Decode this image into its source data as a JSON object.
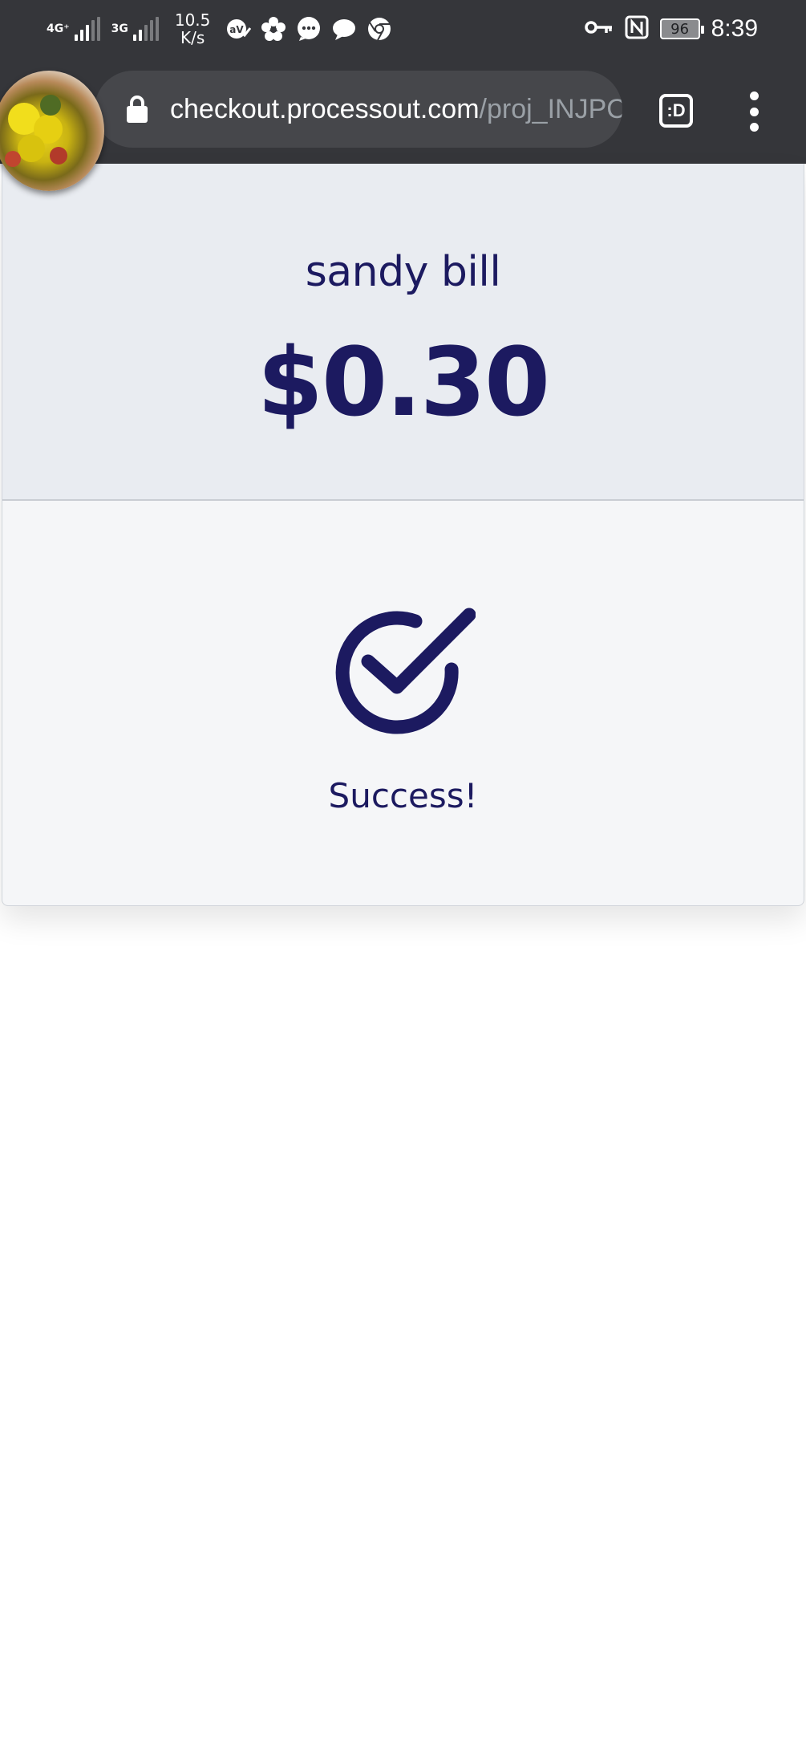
{
  "status_bar": {
    "network_1": "4G⁺",
    "network_2": "3G",
    "speed_value": "10.5",
    "speed_unit": "K/s",
    "battery": "96",
    "time": "8:39"
  },
  "browser": {
    "url_domain": "checkout.processout.com",
    "url_path": "/proj_INJPC",
    "tab_button_label": ":D"
  },
  "checkout": {
    "merchant_name": "sandy bill",
    "amount": "$0.30",
    "status_message": "Success!"
  },
  "colors": {
    "accent": "#1c1a60",
    "header_bg": "#e9ecf1",
    "body_bg": "#f5f6f8",
    "browser_chrome": "#35363a"
  }
}
